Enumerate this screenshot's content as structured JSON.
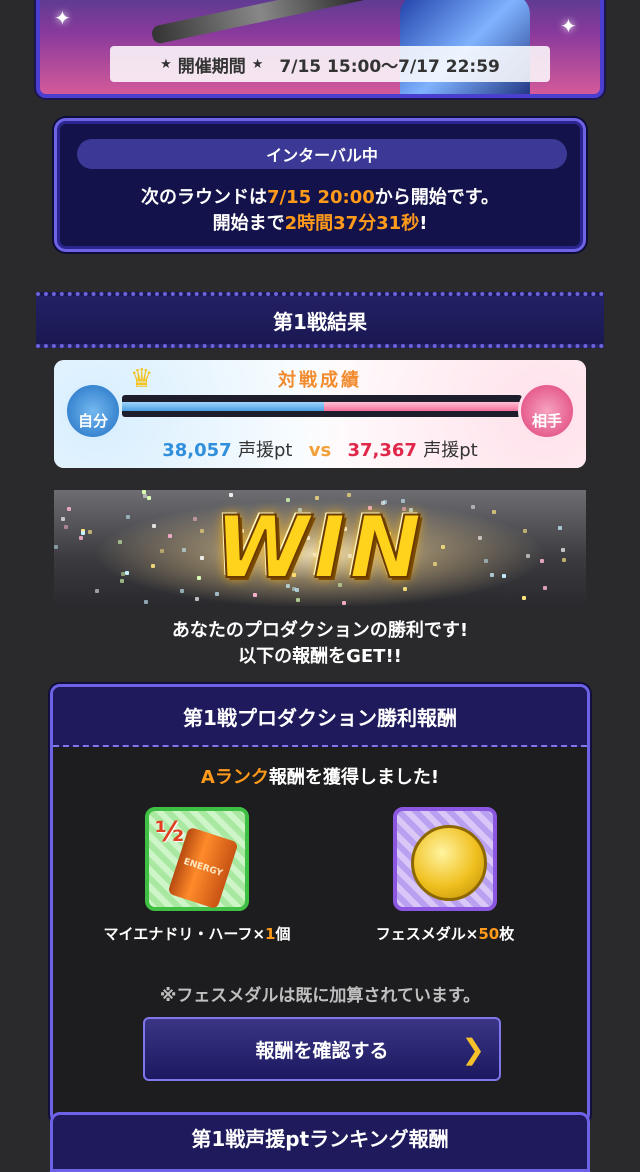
{
  "banner": {
    "period_label": "開催期間",
    "period_value": "7/15 15:00〜7/17 22:59"
  },
  "interval": {
    "status": "インターバル中",
    "next_round_prefix": "次のラウンドは",
    "next_round_time": "7/15 20:00",
    "next_round_suffix": "から開始です。",
    "countdown_prefix": "開始まで",
    "countdown": "2時間37分31秒",
    "countdown_suffix": "!"
  },
  "section": {
    "title": "第1戦結果"
  },
  "battle": {
    "title": "対戦成績",
    "me_label": "自分",
    "opponent_label": "相手",
    "my_score": "38,057",
    "opponent_score": "37,367",
    "unit": "声援pt",
    "vs": "vs",
    "my_share": 0.504,
    "colors": {
      "me": "#2f8fdc",
      "opponent": "#e0274a"
    }
  },
  "result": {
    "banner_word": "WIN",
    "message_line1": "あなたのプロダクションの勝利です!",
    "message_line2": "以下の報酬をGET!!"
  },
  "reward": {
    "header": "第1戦プロダクション勝利報酬",
    "rank": "A",
    "rank_suffix": "ランク",
    "rank_message": "報酬を獲得しました!",
    "items": [
      {
        "name": "マイエナドリ・ハーフ×",
        "count": "1",
        "unit": "個",
        "icon": "energy-drink-icon"
      },
      {
        "name": "フェスメダル×",
        "count": "50",
        "unit": "枚",
        "icon": "fes-medal-icon"
      }
    ],
    "note": "※フェスメダルは既に加算されています。",
    "confirm_button": "報酬を確認する"
  },
  "next_section": {
    "header": "第1戦声援ptランキング報酬"
  }
}
